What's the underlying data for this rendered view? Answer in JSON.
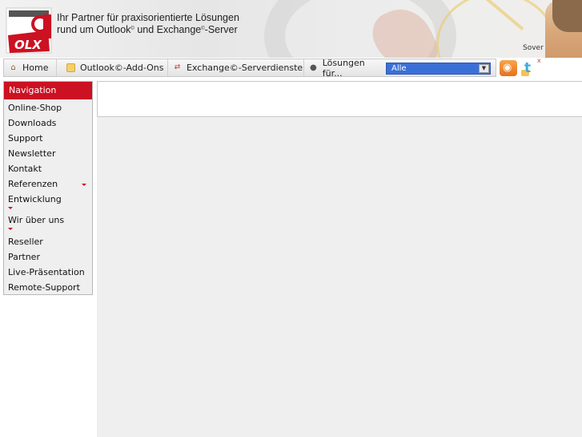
{
  "header": {
    "logo_text": "OLX",
    "tagline_line1": "Ihr Partner für praxisorientierte Lösungen",
    "tagline_line2_pre": "rund um Outlook",
    "tagline_line2_mid": " und Exchange",
    "tagline_line2_post": "-Server",
    "registered_mark": "©",
    "corner_text": "Sover"
  },
  "menu": {
    "home": "Home",
    "outlook": "Outlook©-Add-Ons",
    "exchange": "Exchange©-Serverdienste",
    "loesungen": "Lösungen für...",
    "select_value": "Alle",
    "select_arrow": "▼"
  },
  "social": {
    "rss_glyph": "◉",
    "twitter_glyph": "t",
    "close_glyph": "x"
  },
  "navigation": {
    "heading": "Navigation",
    "items": [
      "Online-Shop",
      "Downloads",
      "Support",
      "Newsletter",
      "Kontakt",
      "Referenzen",
      "Entwicklung",
      "Wir über uns",
      "Reseller",
      "Partner",
      "Live-Präsentation",
      "Remote-Support"
    ]
  },
  "colors": {
    "accent": "#cc1122",
    "select_bg": "#3b6fd8",
    "panel_bg": "#efefef"
  }
}
